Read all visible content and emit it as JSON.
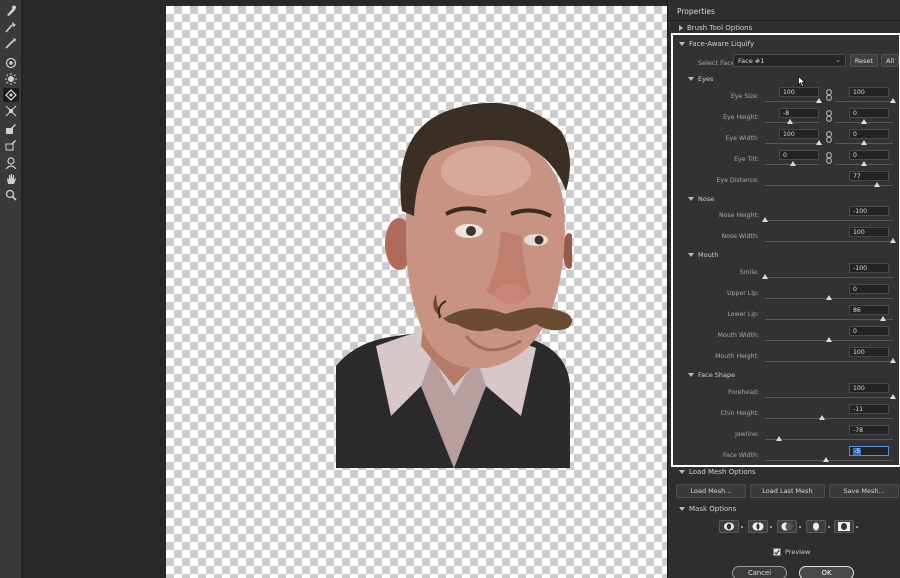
{
  "panel": {
    "title": "Properties",
    "brush_tool_options": "Brush Tool Options",
    "face_aware_liquify": "Face-Aware Liquify",
    "select_face_label": "Select Face:",
    "select_face_value": "Face #1",
    "reset_label": "Reset",
    "all_label": "All"
  },
  "eyes": {
    "heading": "Eyes",
    "eye_size": {
      "label": "Eye Size:",
      "left": "100",
      "right": "100"
    },
    "eye_height": {
      "label": "Eye Height:",
      "left": "-8",
      "right": "0"
    },
    "eye_width": {
      "label": "Eye Width:",
      "left": "100",
      "right": "0"
    },
    "eye_tilt": {
      "label": "Eye Tilt:",
      "left": "0",
      "right": "0"
    },
    "eye_distance": {
      "label": "Eye Distance:",
      "value": "77"
    }
  },
  "nose": {
    "heading": "Nose",
    "nose_height": {
      "label": "Nose Height:",
      "value": "-100"
    },
    "nose_width": {
      "label": "Nose Width:",
      "value": "100"
    }
  },
  "mouth": {
    "heading": "Mouth",
    "smile": {
      "label": "Smile:",
      "value": "-100"
    },
    "upper_lip": {
      "label": "Upper Lip:",
      "value": "0"
    },
    "lower_lip": {
      "label": "Lower Lip:",
      "value": "86"
    },
    "mouth_width": {
      "label": "Mouth Width:",
      "value": "0"
    },
    "mouth_height": {
      "label": "Mouth Height:",
      "value": "100"
    }
  },
  "face_shape": {
    "heading": "Face Shape",
    "forehead": {
      "label": "Forehead:",
      "value": "100"
    },
    "chin_height": {
      "label": "Chin Height:",
      "value": "-11"
    },
    "jawline": {
      "label": "Jawline:",
      "value": "-78"
    },
    "face_width": {
      "label": "Face Width:",
      "value": "-5"
    }
  },
  "load_mesh": {
    "heading": "Load Mesh Options",
    "load_mesh_label": "Load Mesh...",
    "load_last_mesh_label": "Load Last Mesh",
    "save_mesh_label": "Save Mesh..."
  },
  "mask": {
    "heading": "Mask Options"
  },
  "footer": {
    "preview_label": "Preview",
    "cancel_label": "Cancel",
    "ok_label": "OK"
  },
  "tools": [
    "forward-warp-icon",
    "reconstruct-icon",
    "smooth-icon",
    "twirl-icon",
    "pucker-icon",
    "bloat-icon",
    "push-left-icon",
    "freeze-mask-icon",
    "thaw-mask-icon",
    "face-tool-icon",
    "hand-icon",
    "zoom-icon"
  ]
}
